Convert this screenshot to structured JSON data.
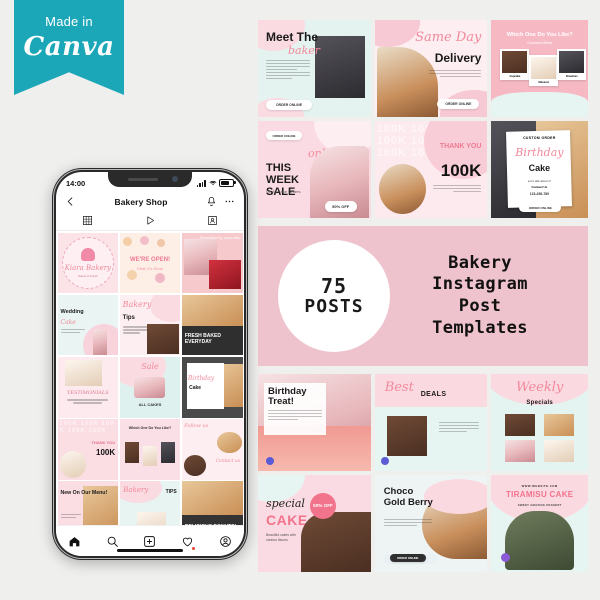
{
  "badge": {
    "made_in": "Made in",
    "brand": "Canva"
  },
  "phone": {
    "status": {
      "time": "14:00",
      "signal_icon": "signal-bars-icon",
      "wifi_icon": "wifi-icon",
      "battery_icon": "battery-icon"
    },
    "appbar": {
      "back_icon": "back-chevron-icon",
      "title": "Bakery Shop",
      "bell_icon": "bell-icon",
      "more_icon": "more-options-icon"
    },
    "tabs": [
      {
        "name": "grid",
        "icon": "grid-icon"
      },
      {
        "name": "reels",
        "icon": "play-icon"
      },
      {
        "name": "tagged",
        "icon": "tagged-person-icon"
      }
    ],
    "feed": [
      {
        "id": "kiara-bakery-logo",
        "title": "Kiara Bakery",
        "sub": "Sweet & Fresh"
      },
      {
        "id": "were-open",
        "title": "WE'RE OPEN!",
        "sub": "Visit Us Now"
      },
      {
        "id": "strawberry-cupcake",
        "title": "Strawberry cupcake",
        "sub": ""
      },
      {
        "id": "wedding-cake",
        "title": "Wedding",
        "sub": "Cake"
      },
      {
        "id": "bakery-tips",
        "title": "Bakery",
        "sub": "Tips"
      },
      {
        "id": "fresh-baked-everyday",
        "title": "FRESH BAKED EVERYDAY",
        "sub": ""
      },
      {
        "id": "testimonials",
        "title": "TESTIMONIALS",
        "sub": ""
      },
      {
        "id": "sale-of-the-week",
        "title": "Sale",
        "sub": "ALL CAKES"
      },
      {
        "id": "birthday-cake-custom",
        "title": "Birthday",
        "sub": "Cake"
      },
      {
        "id": "thank-you-100k",
        "title": "THANK YOU",
        "sub": "100K"
      },
      {
        "id": "which-one-do-you-like",
        "title": "Which One Do You Like?",
        "sub": ""
      },
      {
        "id": "follow-contact-us",
        "title": "Follow us",
        "sub": "Contact us"
      },
      {
        "id": "new-on-our-menu",
        "title": "New On Our Menu!",
        "sub": ""
      },
      {
        "id": "bakery-tips-2",
        "title": "Bakery",
        "sub": "TIPS"
      },
      {
        "id": "delicious-donuts",
        "title": "DELICIOUS DONUTS!",
        "sub": ""
      }
    ],
    "navbar": [
      {
        "name": "home",
        "icon": "home-icon"
      },
      {
        "name": "search",
        "icon": "search-icon"
      },
      {
        "name": "create",
        "icon": "plus-square-icon"
      },
      {
        "name": "activity",
        "icon": "heart-icon",
        "badge": true
      },
      {
        "name": "profile",
        "icon": "profile-icon"
      }
    ]
  },
  "collage": {
    "top": [
      {
        "id": "meet-the-baker",
        "title": "Meet The",
        "script": "baker",
        "button": "ORDER ONLINE"
      },
      {
        "id": "same-day-delivery",
        "script": "Same Day",
        "title": "Delivery",
        "button": "ORDER ONLINE"
      },
      {
        "id": "which-one-do-you-like",
        "title": "Which One Do You Like?",
        "sub": "Comments Below",
        "options": [
          "Cupcake",
          "Macaron",
          "Brownies"
        ]
      },
      {
        "id": "this-week-sale",
        "tag": "ORDER ONLINE",
        "script": "only",
        "title": "THIS WEEK SALE",
        "sub": "On All Cake Orders",
        "button": "50% OFF"
      },
      {
        "id": "thank-you-100k",
        "title": "THANK YOU",
        "value": "100K",
        "watermark": "100K"
      },
      {
        "id": "custom-order-birthday-cake",
        "tag": "CUSTOM ORDER",
        "script": "Birthday",
        "title": "Cake",
        "sub": "Let's talk about it!",
        "contact_label": "Contact Us",
        "phone": "123-456-789",
        "button": "ORDER ONLINE"
      }
    ],
    "banner": {
      "count": "75",
      "count_label": "POSTS",
      "lines": [
        "Bakery",
        "Instagram",
        "Post",
        "Templates"
      ]
    },
    "bottom": [
      {
        "id": "birthday-treat",
        "title": "Birthday Treat!"
      },
      {
        "id": "best-deals",
        "script": "Best",
        "title": "DEALS"
      },
      {
        "id": "weekly-specials",
        "script": "Weekly",
        "title": "Specials"
      },
      {
        "id": "special-cake",
        "script": "special",
        "title": "CAKE",
        "sub": "Beautiful cakes with various flavors",
        "badge": "50% OFF"
      },
      {
        "id": "choco-gold-berry",
        "title": "Choco Gold Berry",
        "button": "ORDER ONLINE"
      },
      {
        "id": "tiramisu-cake",
        "website": "WWW.WEBSITE.COM",
        "title": "TIRAMISU CAKE",
        "sub": "SWEET AMAZING DESSERT"
      }
    ]
  },
  "colors": {
    "canva_teal": "#1ca7b8",
    "banner_pink": "#eec3cd",
    "accent_pink": "#f2899b",
    "page_bg": "#efefee"
  }
}
